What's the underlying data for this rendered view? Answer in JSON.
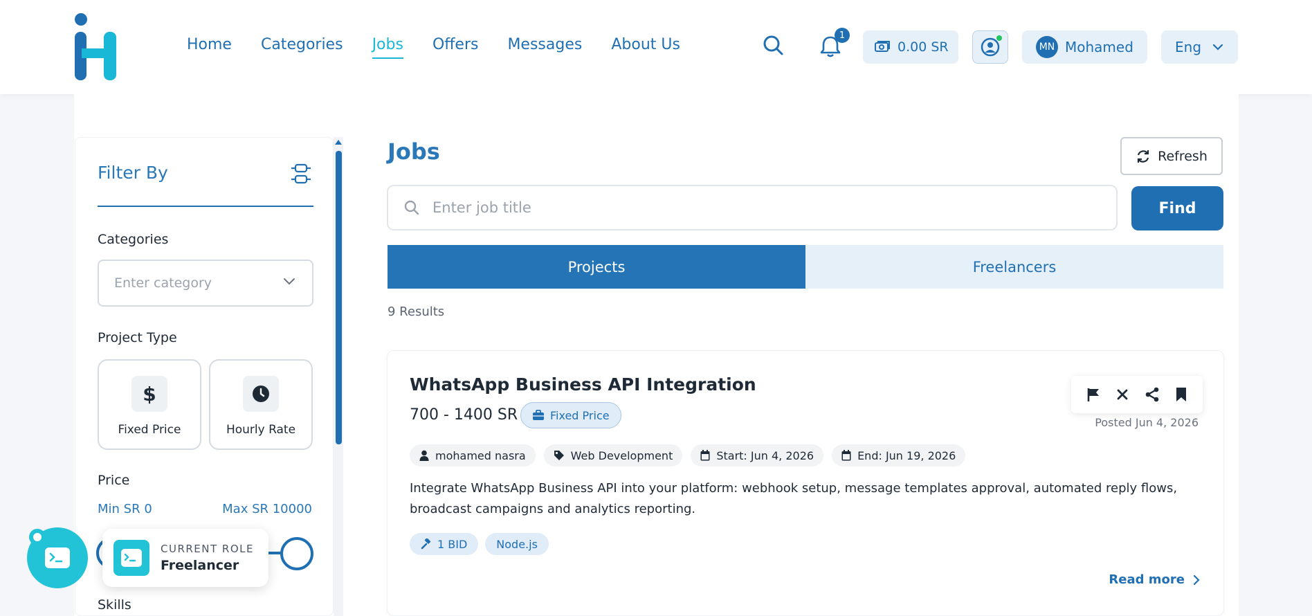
{
  "header": {
    "nav": [
      {
        "label": "Home"
      },
      {
        "label": "Categories"
      },
      {
        "label": "Jobs",
        "active": true
      },
      {
        "label": "Offers"
      },
      {
        "label": "Messages"
      },
      {
        "label": "About Us"
      }
    ],
    "notification_count": "1",
    "wallet_balance": "0.00 SR",
    "user_initials": "MN",
    "user_name": "Mohamed",
    "language": "Eng"
  },
  "sidebar": {
    "title": "Filter By",
    "categories_label": "Categories",
    "categories_placeholder": "Enter category",
    "project_type_label": "Project Type",
    "project_types": [
      "Fixed Price",
      "Hourly Rate"
    ],
    "price_label": "Price",
    "price_min": "Min SR 0",
    "price_max": "Max SR 10000",
    "skills_label": "Skills"
  },
  "role": {
    "caption": "CURRENT ROLE",
    "value": "Freelancer"
  },
  "main": {
    "title": "Jobs",
    "refresh_label": "Refresh",
    "search_placeholder": "Enter job title",
    "find_label": "Find",
    "tabs": [
      {
        "label": "Projects",
        "active": true
      },
      {
        "label": "Freelancers"
      }
    ],
    "results_text": "9 Results"
  },
  "job": {
    "title": "WhatsApp Business API Integration",
    "price": "700 - 1400 SR",
    "price_type": "Fixed Price",
    "posted": "Posted Jun 4, 2026",
    "client": "mohamed nasra",
    "category": "Web Development",
    "start": "Start: Jun 4, 2026",
    "end": "End: Jun 19, 2026",
    "description": "Integrate WhatsApp Business API into your platform: webhook setup, message templates approval, automated reply flows, broadcast campaigns and analytics reporting.",
    "bids": "1 BID",
    "skill_tag": "Node.js",
    "read_more": "Read more"
  },
  "colors": {
    "primary": "#1f6fb2",
    "accent": "#18b8d6",
    "role_teal": "#22c3d6"
  }
}
